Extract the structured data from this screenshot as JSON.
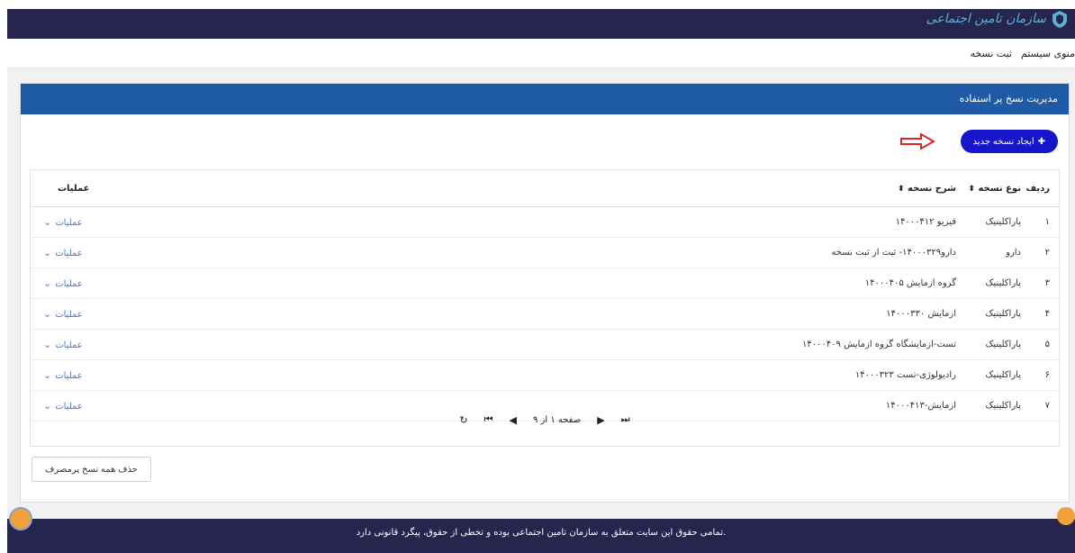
{
  "header": {
    "logo_text": "سازمان تامین اجتماعی"
  },
  "menu": {
    "system": "منوی سیستم",
    "register": "ثبت نسخه"
  },
  "panel": {
    "title": "مدیریت نسخ پر استفاده",
    "new_button": "ایجاد نسخه جدید"
  },
  "table": {
    "headers": {
      "index": "ردیف",
      "type": "نوع نسخه",
      "desc": "شرح نسخه",
      "ops": "عملیات"
    },
    "rows": [
      {
        "index": "۱",
        "type": "پاراکلینیک",
        "desc": "فیزیو ۱۴۰۰۰۴۱۲",
        "ops": "عملیات"
      },
      {
        "index": "۲",
        "type": "دارو",
        "desc": "دارو۱۴۰۰۰۳۲۹- ثبت از ثبت نسخه",
        "ops": "عملیات"
      },
      {
        "index": "۳",
        "type": "پاراکلینیک",
        "desc": "گروه ازمایش ۱۴۰۰۰۴۰۵",
        "ops": "عملیات"
      },
      {
        "index": "۴",
        "type": "پاراکلینیک",
        "desc": "ازمایش ۱۴۰۰۰۳۳۰",
        "ops": "عملیات"
      },
      {
        "index": "۵",
        "type": "پاراکلینیک",
        "desc": "تست-ازمایشگاه گروه ازمایش ۱۴۰۰۰۴۰۹",
        "ops": "عملیات"
      },
      {
        "index": "۶",
        "type": "پاراکلینیک",
        "desc": "رادیولوژی-تست ۱۴۰۰۰۳۲۳",
        "ops": "عملیات"
      },
      {
        "index": "۷",
        "type": "پاراکلینیک",
        "desc": "ازمایش-۱۴۰۰۰۴۱۳",
        "ops": "عملیات"
      }
    ]
  },
  "pager": {
    "text": "صفحه ۱ از ۹"
  },
  "delete_button": "حذف همه نسخ پرمصرف",
  "footer": "تمامی حقوق این سایت متعلق به سازمان تامین اجتماعی بوده و تخطی از حقوق، پیگرد قانونی دارد."
}
